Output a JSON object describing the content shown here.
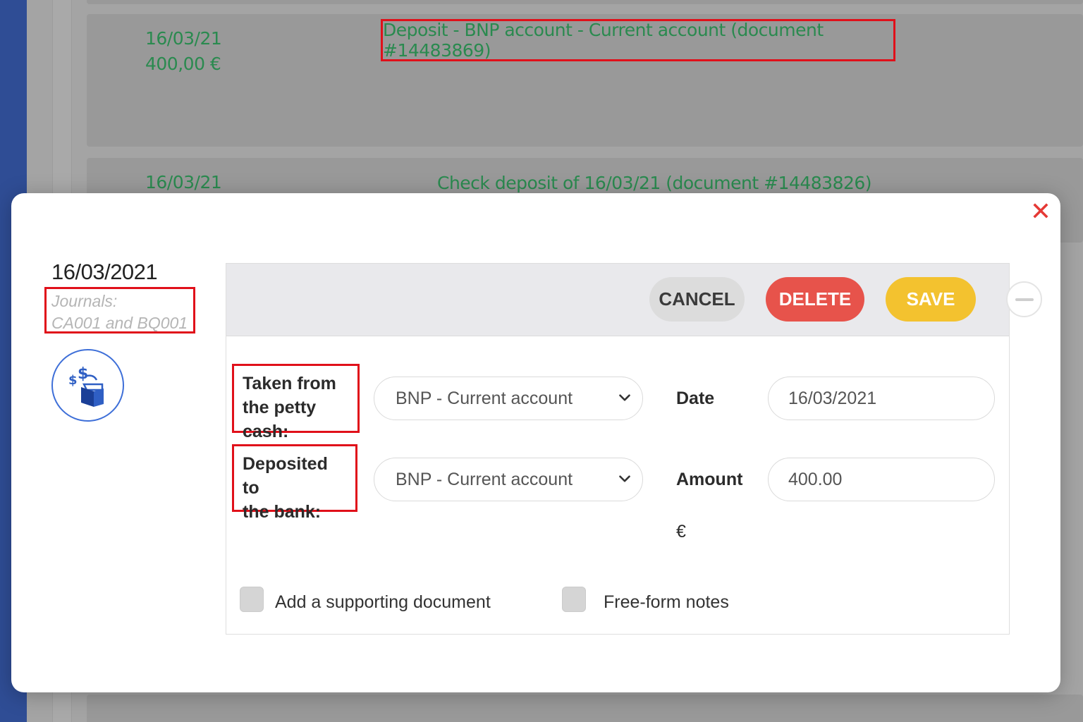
{
  "background": {
    "entries": [
      {
        "date": "16/03/21",
        "amount": "400,00 €",
        "title": "Deposit - BNP account - Current account (document #14483869)"
      },
      {
        "date": "16/03/21",
        "title": "Check deposit of 16/03/21 (document #14483826)"
      }
    ],
    "accent_color": "#2a8a4f"
  },
  "modal": {
    "close_icon": "close-x",
    "date": "16/03/2021",
    "journals_line1": "Journals:",
    "journals_line2": "CA001 and BQ001",
    "operation_icon": "cash-deposit-icon",
    "buttons": {
      "cancel": "CANCEL",
      "delete": "DELETE",
      "save": "SAVE"
    },
    "colors": {
      "delete": "#e7534b",
      "save": "#f3c22f",
      "close": "#e53935",
      "highlight": "#e0101a"
    },
    "form": {
      "taken_label_line1": "Taken from",
      "taken_label_line2": "the petty cash:",
      "taken_value": "BNP - Current account",
      "deposited_label_line1": "Deposited to",
      "deposited_label_line2": "the bank:",
      "deposited_value": "BNP - Current account",
      "date_label": "Date",
      "date_value": "16/03/2021",
      "amount_label": "Amount",
      "amount_value": "400.00",
      "currency": "€"
    },
    "options": {
      "supporting_doc": "Add a supporting document",
      "notes": "Free-form notes"
    }
  }
}
